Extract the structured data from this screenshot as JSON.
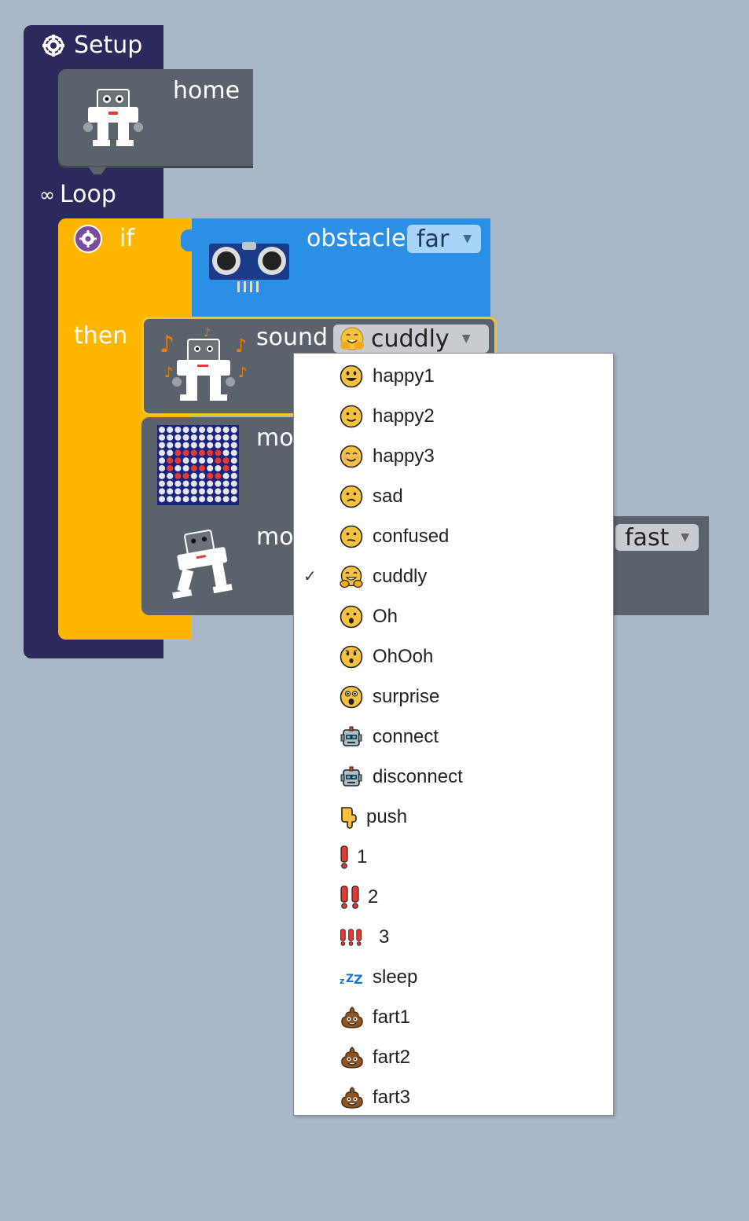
{
  "setup": {
    "title": "Setup"
  },
  "home_block": {
    "label": "home"
  },
  "loop": {
    "symbol": "∞",
    "title": "Loop"
  },
  "if_block": {
    "if_label": "if",
    "then_label": "then"
  },
  "obstacle_block": {
    "label": "obstacle",
    "value": "far"
  },
  "sound_block": {
    "label": "sound",
    "value": "cuddly"
  },
  "mouth_block": {
    "label": "mou"
  },
  "move_block": {
    "label": "mov",
    "speed": "fast"
  },
  "dropdown": {
    "selected": "cuddly",
    "check_mark": "✓",
    "items": [
      {
        "label": "happy1",
        "icon": "grinning-face-icon"
      },
      {
        "label": "happy2",
        "icon": "slightly-smiling-face-icon"
      },
      {
        "label": "happy3",
        "icon": "smiling-face-icon"
      },
      {
        "label": "sad",
        "icon": "frowning-face-icon"
      },
      {
        "label": "confused",
        "icon": "confused-face-icon"
      },
      {
        "label": "cuddly",
        "icon": "hugging-face-icon"
      },
      {
        "label": "Oh",
        "icon": "open-mouth-face-icon"
      },
      {
        "label": "OhOoh",
        "icon": "hushed-face-icon"
      },
      {
        "label": "surprise",
        "icon": "astonished-face-icon"
      },
      {
        "label": "connect",
        "icon": "robot-face-icon"
      },
      {
        "label": "disconnect",
        "icon": "robot-face-icon"
      },
      {
        "label": "push",
        "icon": "pointing-down-hand-icon"
      },
      {
        "label": "1",
        "icon": "exclamation-1-icon"
      },
      {
        "label": "2",
        "icon": "exclamation-2-icon"
      },
      {
        "label": "3",
        "icon": "exclamation-3-icon"
      },
      {
        "label": "sleep",
        "icon": "zzz-icon"
      },
      {
        "label": "fart1",
        "icon": "poop-icon"
      },
      {
        "label": "fart2",
        "icon": "poop-icon"
      },
      {
        "label": "fart3",
        "icon": "poop-icon"
      }
    ]
  },
  "colors": {
    "background": "#a8b8c9",
    "setup_block": "#2c2a5c",
    "if_block": "#ffb600",
    "sensor_block": "#2b8fe5",
    "action_block": "#5a636c",
    "selection_border": "#f4c430"
  }
}
